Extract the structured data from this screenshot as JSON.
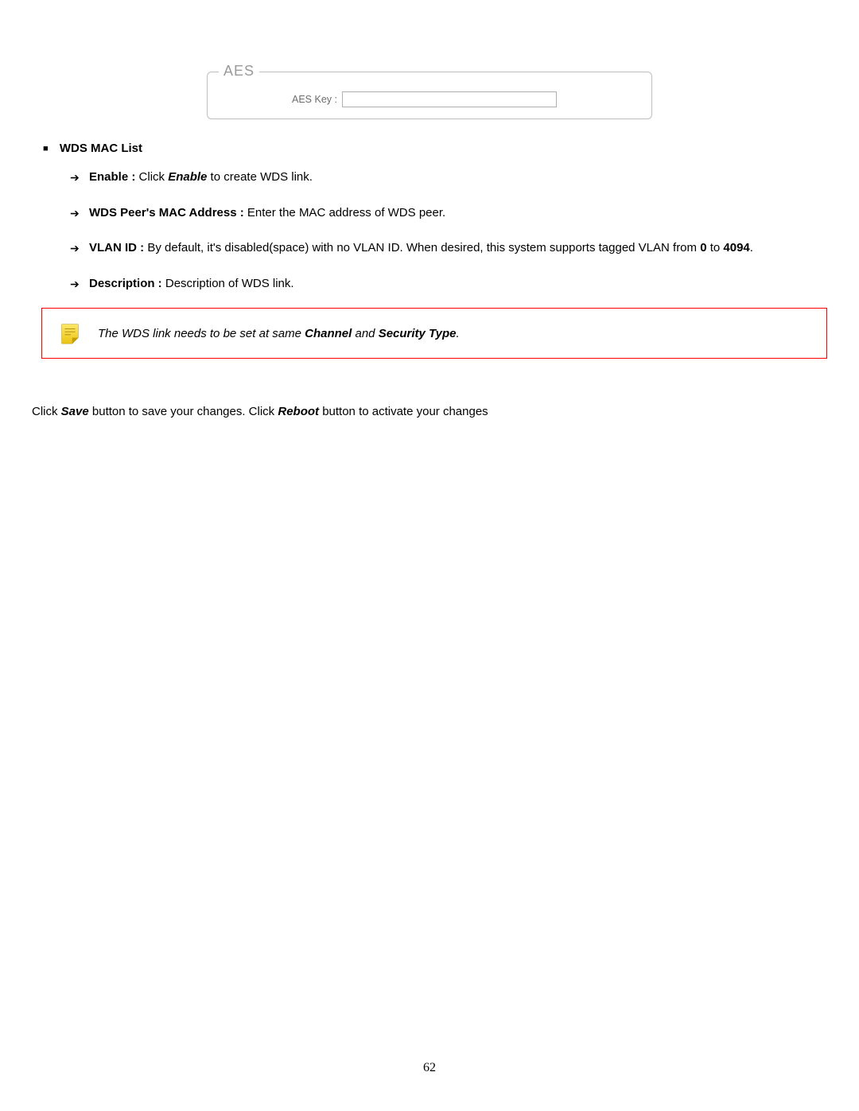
{
  "aes": {
    "legend": "AES",
    "key_label": "AES Key :",
    "key_value": ""
  },
  "section_title": "WDS MAC List",
  "items": [
    {
      "label": "Enable :",
      "desc_pre": " Click ",
      "emph": "Enable",
      "desc_post": " to create WDS link."
    },
    {
      "label": "WDS Peer's MAC Address :",
      "desc_pre": " Enter the MAC address of WDS peer.",
      "emph": "",
      "desc_post": ""
    },
    {
      "label": "VLAN ID :",
      "desc_pre": " By default, it's disabled(space) with no VLAN ID. When desired, this system supports tagged VLAN from ",
      "num1": "0",
      "mid": " to ",
      "num2": "4094",
      "end": "."
    },
    {
      "label": "Description :",
      "desc_pre": " Description of WDS link.",
      "emph": "",
      "desc_post": ""
    }
  ],
  "note": {
    "pre": "The WDS link needs to be set at same ",
    "b1": "Channel",
    "mid": " and ",
    "b2": "Security Type",
    "post": "."
  },
  "closing": {
    "pre": "Click ",
    "b1": "Save",
    "mid1": " button to save your changes. Click ",
    "b2": "Reboot",
    "mid2": " button to activate your changes"
  },
  "page_number": "62"
}
